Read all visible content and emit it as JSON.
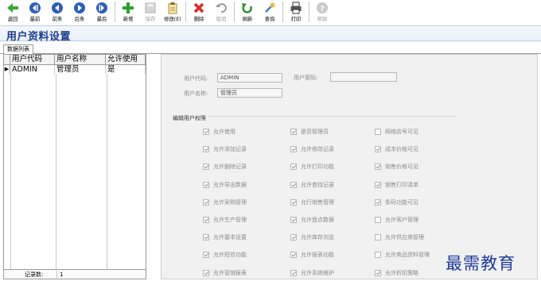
{
  "toolbar": {
    "buttons": [
      {
        "label": "返回",
        "icon": "back-arrow-icon",
        "enabled": true
      },
      {
        "label": "最前",
        "icon": "first-record-icon",
        "enabled": true
      },
      {
        "label": "前条",
        "icon": "previous-record-icon",
        "enabled": true
      },
      {
        "label": "后条",
        "icon": "next-record-icon",
        "enabled": true
      },
      {
        "label": "最后",
        "icon": "last-record-icon",
        "enabled": true
      },
      {
        "label": "新增",
        "icon": "add-icon",
        "enabled": true
      },
      {
        "label": "保存",
        "icon": "save-icon",
        "enabled": false
      },
      {
        "label": "修改(E)",
        "icon": "edit-icon",
        "enabled": true
      },
      {
        "label": "删除",
        "icon": "delete-icon",
        "enabled": true
      },
      {
        "label": "取消",
        "icon": "undo-icon",
        "enabled": false
      },
      {
        "label": "刷新",
        "icon": "refresh-icon",
        "enabled": true
      },
      {
        "label": "查询",
        "icon": "query-icon",
        "enabled": true
      },
      {
        "label": "打印",
        "icon": "print-icon",
        "enabled": true
      },
      {
        "label": "帮助",
        "icon": "help-icon",
        "enabled": false
      }
    ]
  },
  "page": {
    "title": "用户资料设置",
    "tab_label": "数据列表"
  },
  "list": {
    "columns": [
      "用户代码",
      "用户名称",
      "允许使用"
    ],
    "rows": [
      {
        "indicator": "▶",
        "code": "ADMIN",
        "name": "管理员",
        "allowed": "是"
      }
    ],
    "footer_label": "记录数:",
    "footer_value": "1"
  },
  "detail": {
    "user_code_label": "用户代码:",
    "user_code_value": "ADMIN",
    "password_label": "用户密码:",
    "password_value": "",
    "user_name_label": "用户名称:",
    "user_name_value": "管理员",
    "permissions_title": "编辑用户权限",
    "permissions": [
      {
        "label": "允许使用",
        "checked": true
      },
      {
        "label": "是否管理员",
        "checked": true
      },
      {
        "label": "网络店号可见",
        "checked": false
      },
      {
        "label": "允许添加记录",
        "checked": true
      },
      {
        "label": "允许修改记录",
        "checked": true
      },
      {
        "label": "成本价格可见",
        "checked": true
      },
      {
        "label": "允许删除记录",
        "checked": true
      },
      {
        "label": "允许打印功能",
        "checked": true
      },
      {
        "label": "销售价格可见",
        "checked": true
      },
      {
        "label": "允许导出数据",
        "checked": true
      },
      {
        "label": "允许查找记录",
        "checked": true
      },
      {
        "label": "销售打印清单",
        "checked": true
      },
      {
        "label": "允许采购管理",
        "checked": true
      },
      {
        "label": "允行销售管理",
        "checked": true
      },
      {
        "label": "条码功能可见",
        "checked": true
      },
      {
        "label": "允许生产管理",
        "checked": true
      },
      {
        "label": "允许盘点数据",
        "checked": true
      },
      {
        "label": "允许客户管理",
        "checked": false
      },
      {
        "label": "允许基本设置",
        "checked": true
      },
      {
        "label": "允许库存浏览",
        "checked": true
      },
      {
        "label": "允许供应商管理",
        "checked": false
      },
      {
        "label": "允许短信功能",
        "checked": true
      },
      {
        "label": "允许报表功能",
        "checked": true
      },
      {
        "label": "允许商品资料管理",
        "checked": false
      },
      {
        "label": "允许营销报表",
        "checked": true
      },
      {
        "label": "允许系统维护",
        "checked": true
      },
      {
        "label": "允许折扣策略",
        "checked": true
      }
    ]
  },
  "watermark": "最需教育",
  "colors": {
    "title_text": "#1d3d8e",
    "back_icon": "#3aa63a",
    "nav_icon": "#2f5fb3",
    "add_icon": "#2ea02e",
    "delete_icon": "#d62c2c",
    "refresh_icon": "#2b8a2b",
    "watermark": "#1f3a9a"
  }
}
